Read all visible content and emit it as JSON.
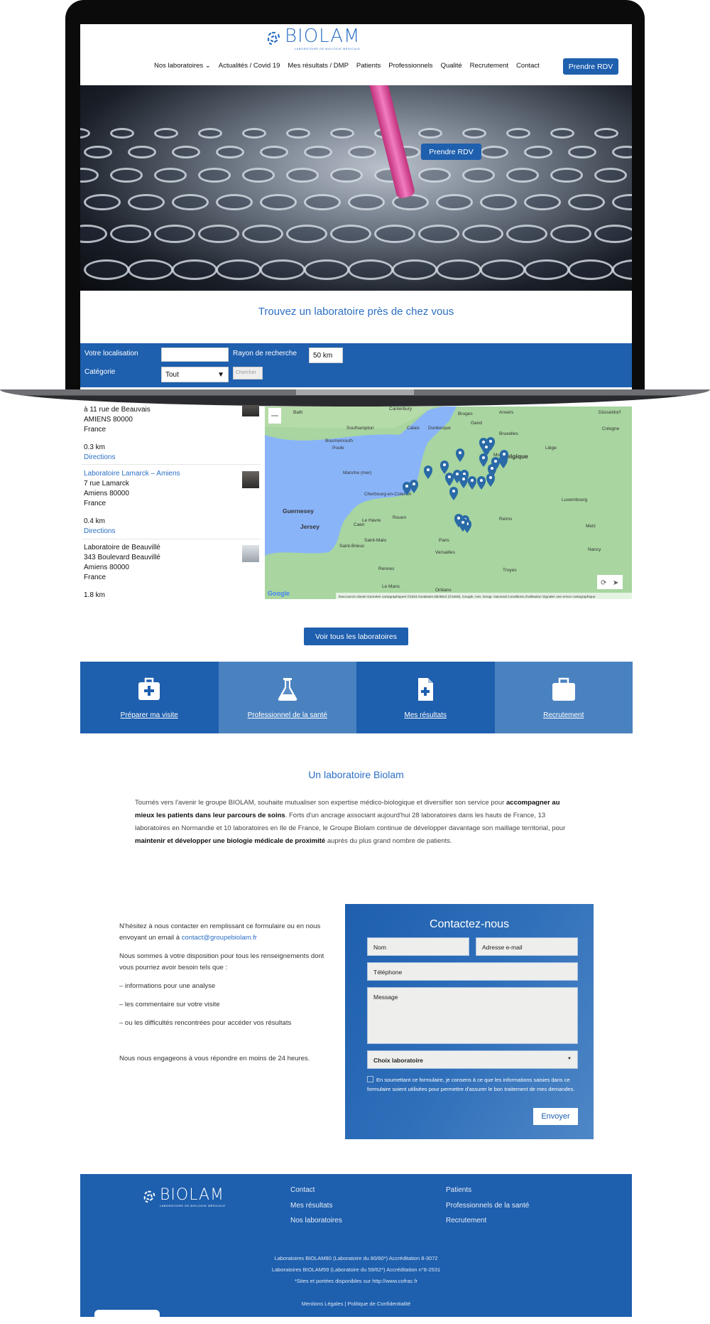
{
  "brand": {
    "name": "BIOLAM",
    "tagline": "LABORATOIRE DE BIOLOGIE MÉDICALE"
  },
  "nav": {
    "items": [
      {
        "label": "Nos laboratoires ⌄"
      },
      {
        "label": "Actualités / Covid 19"
      },
      {
        "label": "Mes résultats / DMP"
      },
      {
        "label": "Patients"
      },
      {
        "label": "Professionnels"
      },
      {
        "label": "Qualité"
      },
      {
        "label": "Recrutement"
      },
      {
        "label": "Contact"
      }
    ],
    "cta": "Prendre RDV"
  },
  "hero": {
    "cta": "Prendre RDV"
  },
  "finder": {
    "title": "Trouvez un laboratoire près de chez vous",
    "location_label": "Votre localisation",
    "location_value": "",
    "radius_label": "Rayon de recherche",
    "radius_value": "50 km",
    "category_label": "Catégorie",
    "category_value": "Tout",
    "search_button": "Chercher"
  },
  "labs": [
    {
      "name": "",
      "address": "à 11 rue de Beauvais",
      "city": "AMIENS 80000",
      "country": "France",
      "distance": "0.3 km",
      "directions": "Directions"
    },
    {
      "name": "Laboratoire Lamarck – Amiens",
      "address": "7 rue Lamarck",
      "city": "Amiens 80000",
      "country": "France",
      "distance": "0.4 km",
      "directions": "Directions"
    },
    {
      "name": "Laboratoire de Beauvillé",
      "address": "343 Boulevard Beauvillé",
      "city": "Amiens 80000",
      "country": "France",
      "distance": "1.8 km",
      "directions": ""
    }
  ],
  "map": {
    "labels": [
      "Bath",
      "Southampton",
      "Bournemouth",
      "Poole",
      "Manche (mer)",
      "Cherbourg-en-Cotentin",
      "Guernesey",
      "Jersey",
      "Saint-Malo",
      "Saint-Brieuc",
      "Rennes",
      "Caen",
      "Le Havre",
      "Rouen",
      "Calais",
      "Dunkerque",
      "Bruges",
      "Gand",
      "Anvers",
      "Bruxelles",
      "Belgique",
      "Liège",
      "Mons",
      "Düsseldorf",
      "Cologne",
      "Luxembourg",
      "Reims",
      "Metz",
      "Nancy",
      "Paris",
      "Versailles",
      "Troyes",
      "Orléans",
      "Le Mans",
      "Canterbury"
    ],
    "attribution": "Raccourcis clavier   Données cartographiques ©2023 GeoBasis-DE/BKG (©2009), Google, Inst. Geogr. Nacional   Conditions d'utilisation   Signaler une erreur cartographique",
    "google": "Google",
    "sea_color": "#8ab4f8",
    "land_color": "#a8d5a0",
    "marker_color": "#2a6aa6"
  },
  "all_labs_button": "Voir tous les laboratoires",
  "tiles": [
    {
      "label": "Préparer ma visite",
      "icon": "medical-kit-icon"
    },
    {
      "label": "Professionnel de la santé",
      "icon": "flask-icon"
    },
    {
      "label": "Mes résultats",
      "icon": "medical-file-icon"
    },
    {
      "label": "Recrutement",
      "icon": "briefcase-icon"
    }
  ],
  "about": {
    "title": "Un laboratoire Biolam",
    "p1": "Tournés vers l'avenir le groupe BIOLAM, souhaite mutualiser son expertise médico-biologique et diversifier son service pour ",
    "b1": "accompagner au mieux les patients dans leur parcours de soins",
    "p2": ". Forts d'un ancrage associant aujourd'hui 28 laboratoires dans les hauts de France, 13 laboratoires en Normandie et 10 laboratoires en Ile de France, le Groupe Biolam continue de développer davantage son maillage territorial, pour ",
    "b2": "maintenir et développer une biologie médicale de proximité",
    "p3": " auprès du plus grand nombre de patients."
  },
  "contact": {
    "intro": "N'hésitez à nous contacter en remplissant ce formulaire ou en nous envoyant un email à ",
    "email": "contact@groupebiolam.fr",
    "line2": "Nous sommes à votre disposition pour tous les renseignements dont vous pourriez avoir besoin tels que :",
    "bullets": [
      "– informations pour une analyse",
      "– les commentaire sur votre visite",
      "– ou les difficultés rencontrées pour accéder vos résultats"
    ],
    "closing": "Nous nous engageons à vous répondre en moins de 24 heures."
  },
  "form": {
    "title": "Contactez-nous",
    "name": "Nom",
    "email": "Adresse e-mail",
    "phone": "Téléphone",
    "message": "Message",
    "lab_select": "Choix laboratoire",
    "consent": "En soumettant ce formulaire, je consens à ce que les informations saisies dans ce formulaire soient utilisées pour permettre d'assurer le bon traitement de mes demandes.",
    "submit": "Envoyer"
  },
  "footer": {
    "col1": [
      "Contact",
      "Mes résultats",
      "Nos laboratoires"
    ],
    "col2": [
      "Patients",
      "Professionnels de la santé",
      "Recrutement"
    ],
    "legal": [
      "Laboratoires BIOLAM80 (Laboratoire du 80/60*) Accréditation 8-3072",
      "Laboratoires BIOLAM59 (Laboratoire du 59/62*) Accréditation n°8-2531",
      "*Sites et portées disponibles sur http://www.cofrac.fr"
    ],
    "links": "Mentions Légales | Politique de Confidentialité"
  },
  "colors": {
    "primary": "#1e5fae",
    "tile_light": "#4a82c0",
    "accent_text": "#2b6fc4"
  }
}
